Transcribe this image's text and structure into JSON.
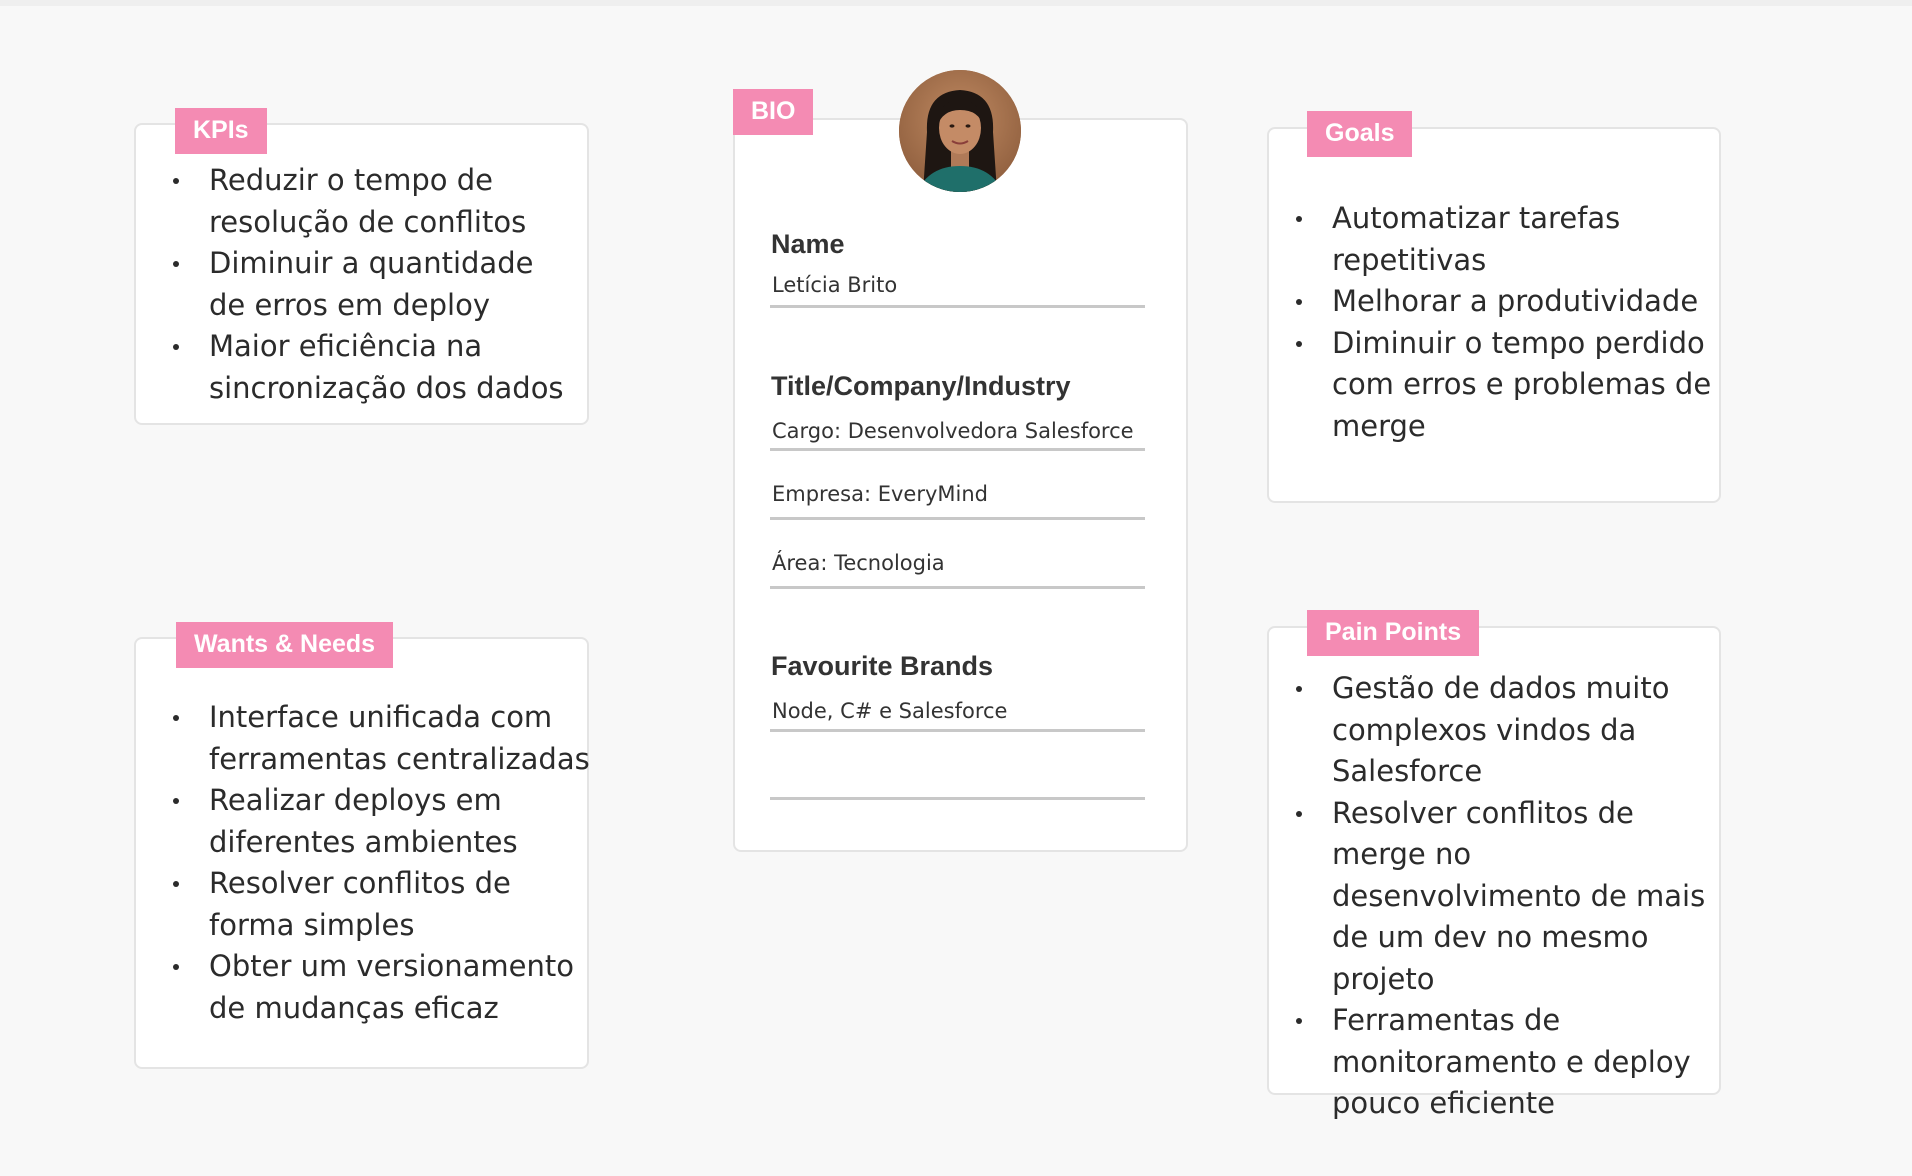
{
  "colors": {
    "background": "#f8f8f8",
    "card": "#ffffff",
    "tag": "#f48bb3",
    "border": "#e4e4e4",
    "divider": "#c8c8c8",
    "text": "#2b2b2b"
  },
  "kpis": {
    "tag": "KPIs",
    "items": [
      "Reduzir o tempo de resolução de conflitos",
      "Diminuir a quantidade de erros em deploy",
      "Maior eficiência na sincronização dos dados"
    ]
  },
  "wants_needs": {
    "tag": "Wants & Needs",
    "items": [
      "Interface unificada com ferramentas centralizadas",
      "Realizar deploys em diferentes ambientes",
      "Resolver conflitos de forma simples",
      "Obter um versionamento de mudanças eficaz"
    ]
  },
  "bio": {
    "tag": "BIO",
    "avatar_icon": "person-portrait-icon",
    "name_label": "Name",
    "name_value": "Letícia Brito",
    "title_label": "Title/Company/Industry",
    "cargo": "Cargo: Desenvolvedora Salesforce",
    "empresa": "Empresa: EveryMind",
    "area": "Área: Tecnologia",
    "brands_label": "Favourite Brands",
    "brands_value": "Node, C# e Salesforce"
  },
  "goals": {
    "tag": "Goals",
    "items": [
      "Automatizar tarefas repetitivas",
      "Melhorar a produtividade",
      "Diminuir o tempo perdido com erros e problemas de merge"
    ]
  },
  "pain_points": {
    "tag": "Pain Points",
    "items": [
      "Gestão de dados muito complexos vindos da Salesforce",
      "Resolver conflitos de merge no desenvolvimento de mais de um dev no mesmo projeto",
      "Ferramentas de monitoramento e deploy pouco eficiente"
    ]
  }
}
